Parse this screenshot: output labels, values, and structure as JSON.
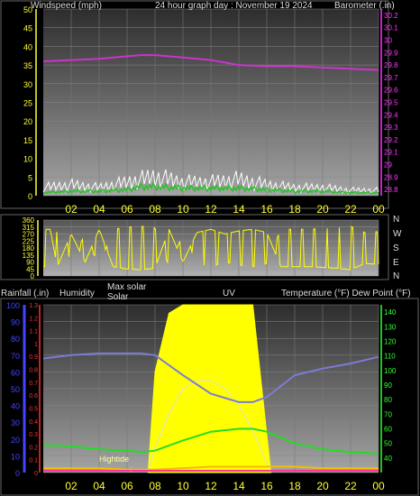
{
  "colors": {
    "background": "#000000",
    "plot_top": "#3a3a3a",
    "plot_bottom": "#a8a8a8",
    "gust": "#ffffff",
    "wind": "#22c322",
    "barometer": "#cc33cc",
    "direction": "#ffff00",
    "humidity": "#7b7bd6",
    "solar": "#ffff00",
    "temperature": "#22dd22",
    "dew_point": "#f0c000",
    "uv": "#ff3333",
    "rain": "#ff3399",
    "tick_yellow": "#ffff33",
    "tick_magenta": "#ff33ff",
    "tick_green": "#33ff33",
    "tick_red": "#ff3333",
    "tick_blue": "#4444ff"
  },
  "header": {
    "title": "24 hour graph day : November 19 2024",
    "wind_label": "Windspeed (mph)",
    "baro_label": "Barometer (.in)"
  },
  "compass_labels": [
    "N",
    "W",
    "S",
    "E",
    "N"
  ],
  "bottom_labels": {
    "rainfall": "Rainfall (.in)",
    "humidity": "Humidity",
    "max_solar": "Max solar",
    "solar": "Solar",
    "uv": "UV",
    "temperature": "Temperature (°F) Dew Point (°F)",
    "hightide": "Hightide"
  },
  "chart_data": [
    {
      "type": "line",
      "name": "wind-barometer",
      "x_ticks": [
        "02",
        "04",
        "06",
        "08",
        "10",
        "12",
        "14",
        "16",
        "18",
        "20",
        "22",
        "00"
      ],
      "left_axis": {
        "label": "Windspeed (mph)",
        "ticks": [
          0,
          5,
          10,
          15,
          20,
          25,
          30,
          35,
          40,
          45,
          50
        ],
        "ylim": [
          0,
          50
        ]
      },
      "right_axis": {
        "label": "Barometer (.in)",
        "ticks": [
          "28.8",
          "28.9",
          "29",
          "29.1",
          "29.2",
          "29.3",
          "29.4",
          "29.5",
          "29.6",
          "29.7",
          "29.8",
          "29.9",
          "30",
          "30.1",
          "30.2"
        ],
        "ylim": [
          28.75,
          30.25
        ]
      },
      "x_hours": [
        0,
        2,
        4,
        6,
        7,
        8,
        10,
        12,
        14,
        16,
        18,
        20,
        22,
        24
      ],
      "barometer": [
        29.83,
        29.84,
        29.85,
        29.87,
        29.88,
        29.88,
        29.86,
        29.84,
        29.8,
        29.79,
        29.79,
        29.78,
        29.77,
        29.76
      ],
      "gust": [
        3,
        4,
        3,
        5,
        6,
        7,
        5,
        5,
        6,
        4,
        3,
        3,
        2,
        2
      ],
      "wind": [
        1,
        1.5,
        1.5,
        2,
        3,
        3,
        2.5,
        2.5,
        2.5,
        2,
        1.5,
        1.5,
        1,
        1
      ]
    },
    {
      "type": "scatter",
      "name": "wind-direction",
      "x_ticks": [
        "02",
        "04",
        "06",
        "08",
        "10",
        "12",
        "14",
        "16",
        "18",
        "20",
        "22",
        "00"
      ],
      "y_ticks": [
        0,
        45,
        90,
        135,
        180,
        225,
        270,
        315,
        360
      ],
      "ylim": [
        0,
        360
      ],
      "note": "direction samples shown as dense vertical strokes in the original",
      "x_hours": [
        0.5,
        1,
        2,
        3,
        4,
        5,
        6,
        7,
        8,
        9,
        10,
        11,
        12,
        13,
        14,
        15,
        16,
        17,
        19,
        21,
        22,
        23,
        24
      ],
      "direction": [
        300,
        60,
        270,
        90,
        300,
        60,
        45,
        40,
        50,
        300,
        90,
        280,
        300,
        270,
        290,
        300,
        280,
        60,
        60,
        50,
        40,
        80,
        75
      ]
    },
    {
      "type": "line",
      "name": "solar-temperature",
      "x_ticks": [
        "02",
        "04",
        "06",
        "08",
        "10",
        "12",
        "14",
        "16",
        "18",
        "20",
        "22",
        "00"
      ],
      "left_axis_rain": {
        "label": "Rainfall (.in)",
        "ticks": [
          "0",
          "0.1",
          "0.2",
          "0.3",
          "0.4",
          "0.5",
          "0.6",
          "0.7",
          "0.8",
          "0.9",
          "1",
          "1.1",
          "1.2",
          "1.3"
        ],
        "ylim": [
          0,
          1.3
        ]
      },
      "left_axis_humidity": {
        "label": "Humidity",
        "ticks": [
          0,
          10,
          20,
          30,
          40,
          50,
          60,
          70,
          80,
          90,
          100
        ],
        "ylim": [
          0,
          100
        ]
      },
      "right_axis": {
        "label": "Temperature (°F) Dew Point (°F)",
        "ticks": [
          40,
          50,
          60,
          70,
          80,
          90,
          100,
          110,
          120,
          130,
          140
        ],
        "ylim": [
          30,
          145
        ]
      },
      "x_hours": [
        0,
        2,
        4,
        6,
        7,
        8,
        10,
        12,
        14,
        15,
        16,
        18,
        20,
        22,
        24
      ],
      "humidity": [
        68,
        70,
        71,
        71,
        71,
        70,
        58,
        47,
        42,
        42,
        45,
        58,
        62,
        65,
        69
      ],
      "temperature": [
        49,
        48,
        46,
        45,
        44,
        45,
        52,
        58,
        60,
        60,
        58,
        50,
        46,
        44,
        43
      ],
      "dew_point": [
        33,
        33,
        33,
        32,
        32,
        32,
        33,
        34,
        34,
        34,
        34,
        34,
        33,
        33,
        33
      ],
      "solar_x": [
        7.5,
        8,
        9,
        10,
        11,
        12,
        13,
        14,
        15,
        16.3
      ],
      "solar": [
        0,
        60,
        95,
        100,
        100,
        100,
        100,
        100,
        100,
        0
      ],
      "max_solar": [
        0,
        15,
        35,
        50,
        55,
        55,
        50,
        40,
        25,
        0
      ],
      "hightide_hour": 6.3
    }
  ]
}
